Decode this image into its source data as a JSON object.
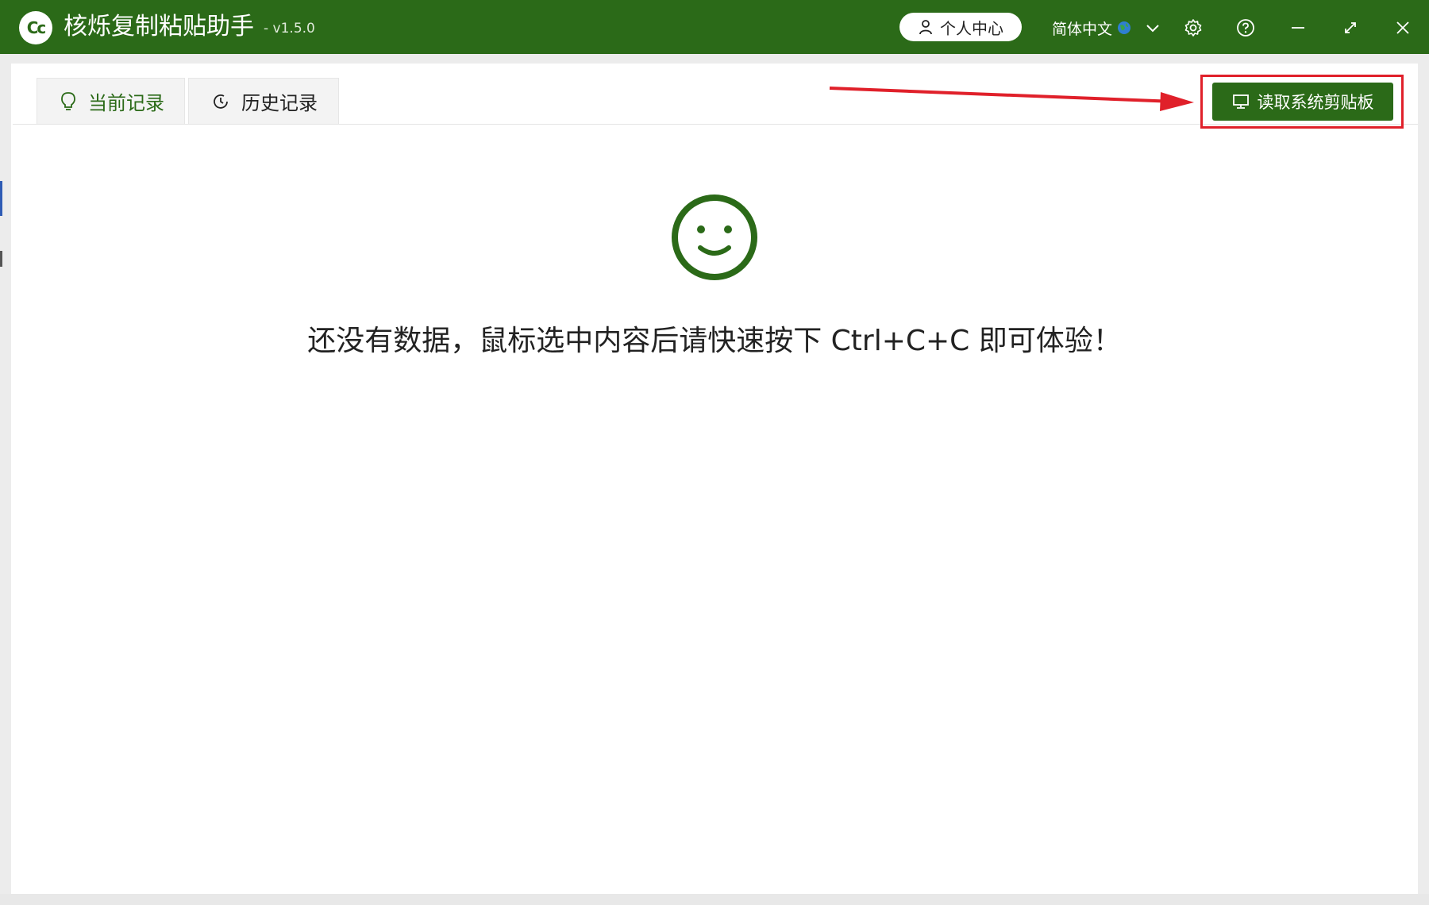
{
  "titlebar": {
    "app_title": "核烁复制粘贴助手",
    "version": "- v1.5.0",
    "logo_text": "Cc",
    "user_center_label": "个人中心",
    "language_label": "简体中文",
    "icons": [
      "user-icon",
      "globe-icon",
      "chevron-down-icon",
      "gear-icon",
      "help-icon",
      "minimize-icon",
      "maximize-icon",
      "close-icon"
    ]
  },
  "tabs": [
    {
      "label": "当前记录",
      "icon": "lightbulb-icon",
      "active": true
    },
    {
      "label": "历史记录",
      "icon": "clock-icon",
      "active": false
    }
  ],
  "toolbar": {
    "read_clipboard_label": "读取系统剪贴板",
    "read_clipboard_icon": "monitor-icon"
  },
  "main": {
    "empty_message": "还没有数据，鼠标选中内容后请快速按下 Ctrl+C+C 即可体验！",
    "empty_icon": "smiley-icon"
  },
  "colors": {
    "brand": "#2b6a18",
    "annotation": "#e0202a"
  }
}
